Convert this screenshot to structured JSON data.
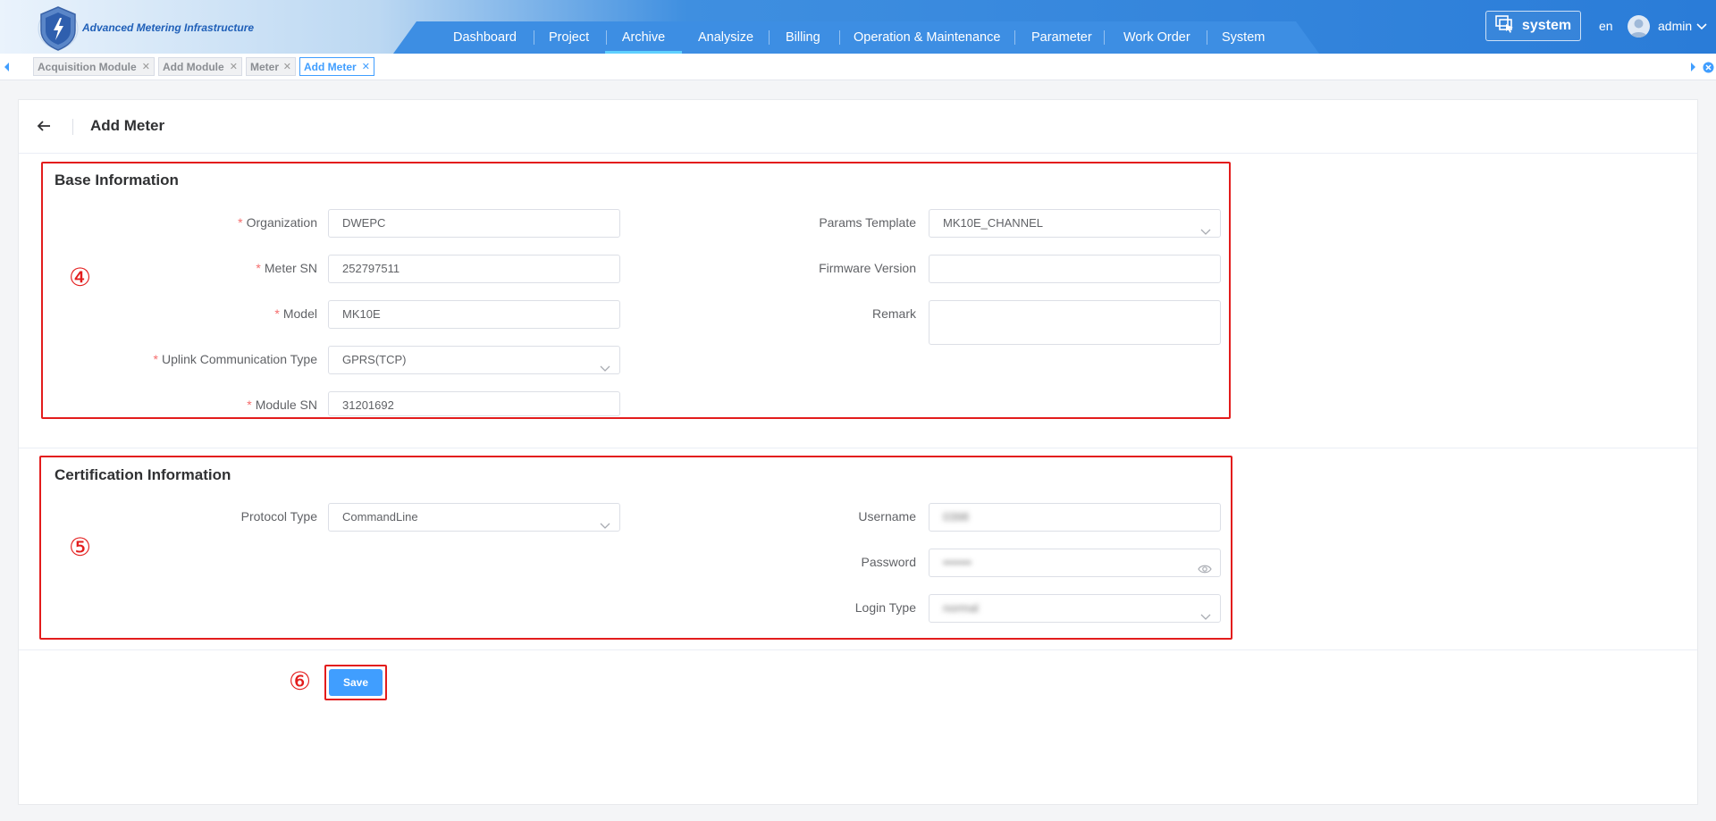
{
  "header": {
    "app_title": "Advanced Metering Infrastructure",
    "nav": [
      {
        "label": "Dashboard"
      },
      {
        "label": "Project"
      },
      {
        "label": "Archive",
        "active": true
      },
      {
        "label": "Analysize"
      },
      {
        "label": "Billing"
      },
      {
        "label": "Operation & Maintenance"
      },
      {
        "label": "Parameter"
      },
      {
        "label": "Work Order"
      },
      {
        "label": "System"
      }
    ],
    "system_button": "system",
    "language": "en",
    "user": "admin"
  },
  "tabs": [
    {
      "label": "Acquisition Module"
    },
    {
      "label": "Add Module"
    },
    {
      "label": "Meter"
    },
    {
      "label": "Add Meter",
      "active": true
    }
  ],
  "page": {
    "title": "Add Meter"
  },
  "base_info": {
    "title": "Base Information",
    "annotation": "④",
    "organization": {
      "label": "Organization",
      "value": "DWEPC"
    },
    "meter_sn": {
      "label": "Meter SN",
      "value": "252797511"
    },
    "model": {
      "label": "Model",
      "value": "MK10E"
    },
    "uplink_type": {
      "label": "Uplink Communication Type",
      "value": "GPRS(TCP)"
    },
    "module_sn": {
      "label": "Module SN",
      "value": "31201692"
    },
    "params_template": {
      "label": "Params Template",
      "value": "MK10E_CHANNEL"
    },
    "firmware_version": {
      "label": "Firmware Version",
      "value": ""
    },
    "remark": {
      "label": "Remark",
      "value": ""
    }
  },
  "cert_info": {
    "title": "Certification Information",
    "annotation": "⑤",
    "protocol_type": {
      "label": "Protocol Type",
      "value": "CommandLine"
    },
    "username": {
      "label": "Username",
      "value": "0398"
    },
    "password": {
      "label": "Password",
      "value": "•••••••"
    },
    "login_type": {
      "label": "Login Type",
      "value": "normal"
    }
  },
  "actions": {
    "annotation": "⑥",
    "save_label": "Save"
  },
  "colors": {
    "primary": "#409eff",
    "annotation_red": "#e31c1c",
    "required": "#f56c6c",
    "nav_bar": "#3d8ee3"
  }
}
